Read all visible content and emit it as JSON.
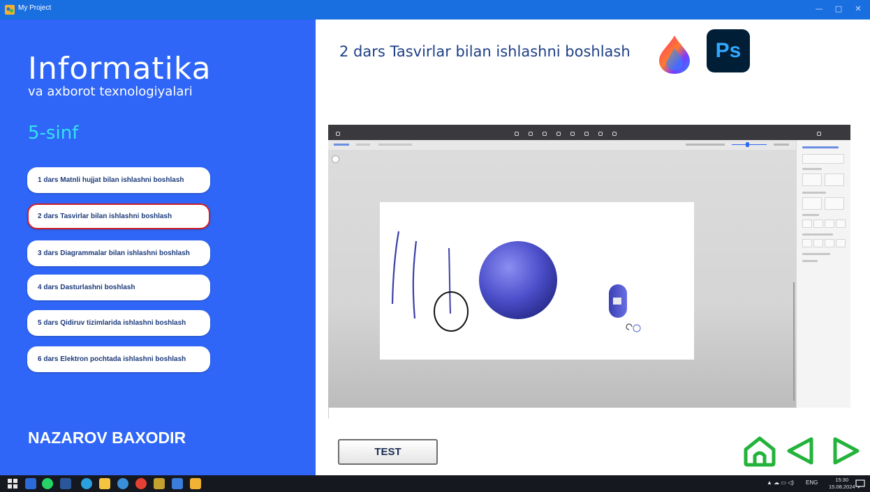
{
  "window": {
    "title": "My Project",
    "controls": {
      "minimize": "—",
      "maximize": "□",
      "close": "✕"
    }
  },
  "sidebar": {
    "subject_title": "Informatika",
    "subject_subtitle": "va axborot texnologiyalari",
    "grade": "5-sinf",
    "lessons": [
      {
        "label": "1 dars Matnli hujjat bilan ishlashni boshlash",
        "active": false
      },
      {
        "label": "2 dars Tasvirlar bilan ishlashni boshlash",
        "active": true
      },
      {
        "label": "3 dars Diagrammalar bilan ishlashni boshlash",
        "active": false
      },
      {
        "label": "4 dars Dasturlashni boshlash",
        "active": false
      },
      {
        "label": "5 dars Qidiruv tizimlarida ishlashni boshlash",
        "active": false
      },
      {
        "label": "6 dars Elektron pochtada ishlashni boshlash",
        "active": false
      }
    ],
    "author": "NAZAROV BAXODIR"
  },
  "main": {
    "heading": "2 dars Tasvirlar bilan ishlashni boshlash",
    "logos": {
      "photoshop_text": "Ps",
      "fresco": "fresco-logo",
      "photoshop": "photoshop-logo"
    },
    "test_button": "TEST",
    "nav": {
      "home": "home-icon",
      "prev": "triangle-left-icon",
      "next": "triangle-right-icon"
    }
  },
  "colors": {
    "sidebar_bg": "#2f66f7",
    "titlebar_bg": "#1a6fe0",
    "grade_text": "#34e3f0",
    "heading_text": "#1d3f86",
    "nav_green": "#23b33a",
    "active_border": "#d0202a",
    "taskbar_bg": "#16181f"
  },
  "taskbar": {
    "tray_text": "ENG",
    "time": "15:30",
    "date": "15.08.2024"
  }
}
